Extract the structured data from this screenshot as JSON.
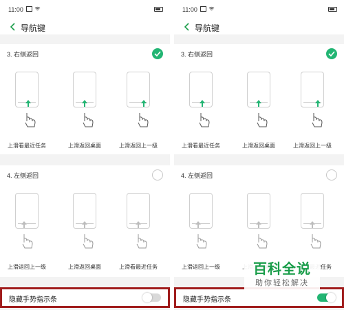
{
  "status_bar": {
    "time": "11:00"
  },
  "nav": {
    "title": "导航键"
  },
  "sections": [
    {
      "title": "3. 右侧返回",
      "options": [
        "上滑看最近任务",
        "上滑返回桌面",
        "上滑返回上一级"
      ]
    },
    {
      "title": "4. 左侧返回",
      "options": [
        "上滑返回上一级",
        "上滑返回桌面",
        "上滑看最近任务"
      ]
    }
  ],
  "toggle": {
    "label": "隐藏手势指示条"
  },
  "panels": [
    {
      "id": "left",
      "selected_section": 0,
      "toggle_on": false
    },
    {
      "id": "right",
      "selected_section": 0,
      "toggle_on": true
    }
  ],
  "colors": {
    "accent": "#22b573",
    "highlight_border": "#a01c1c"
  },
  "watermark": {
    "title": "百科全说",
    "subtitle": "助你轻松解决"
  }
}
